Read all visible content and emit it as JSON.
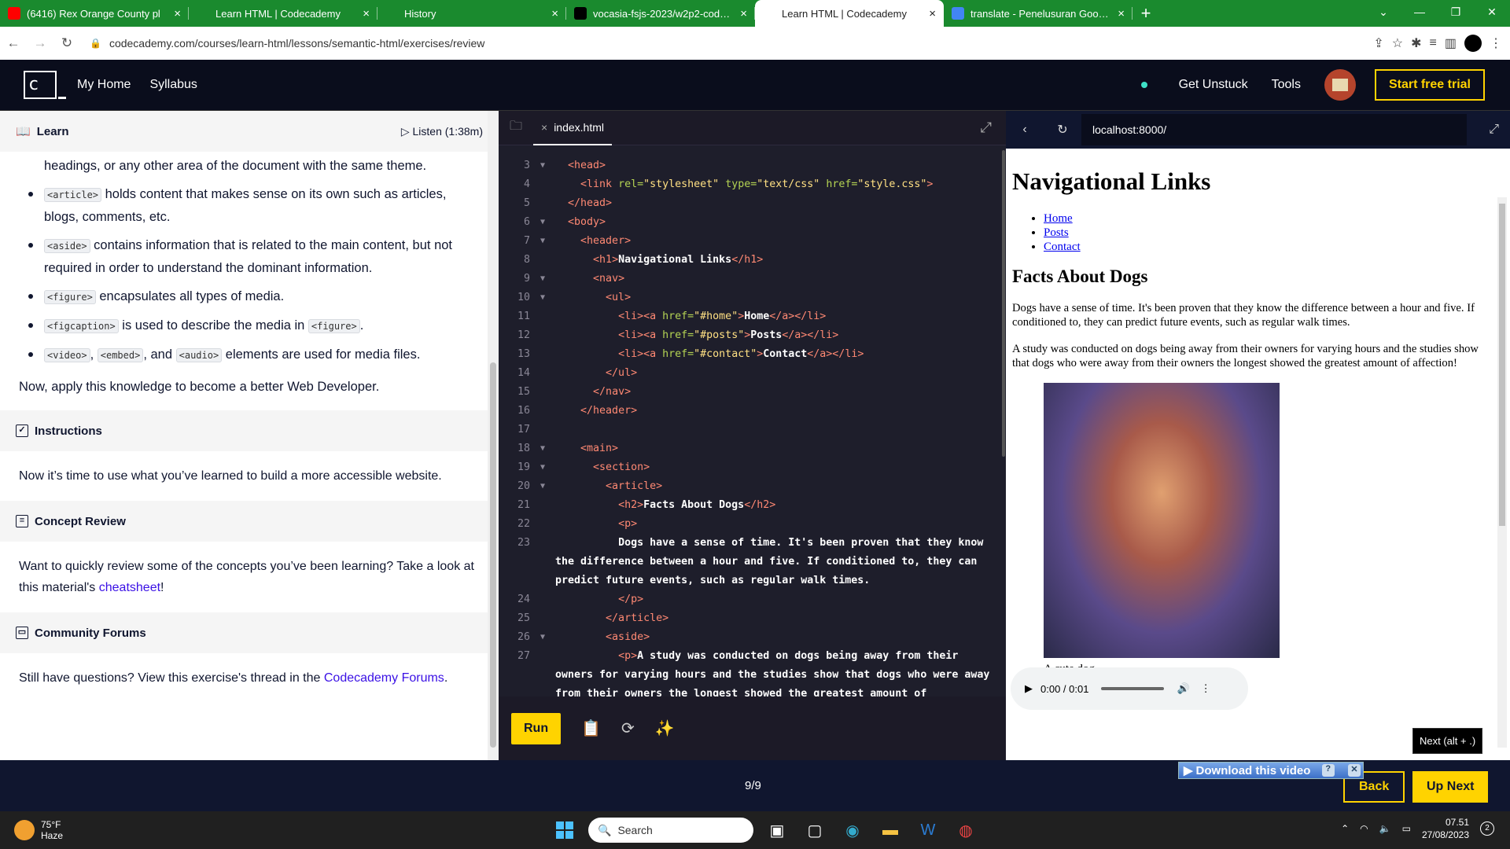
{
  "browser": {
    "tabs": [
      {
        "title": "(6416) Rex Orange County pl",
        "icon": "youtube-icon",
        "color": "#ff0000",
        "active": false
      },
      {
        "title": "Learn HTML | Codecademy",
        "icon": "codecademy-icon",
        "color": "#1a8a2e",
        "active": false
      },
      {
        "title": "History",
        "icon": "history-icon",
        "color": "#1a8a2e",
        "active": false
      },
      {
        "title": "vocasia-fsjs-2023/w2p2-codeca",
        "icon": "github-icon",
        "color": "#000000",
        "active": false
      },
      {
        "title": "Learn HTML | Codecademy",
        "icon": "codecademy-icon",
        "color": "#ffffff",
        "active": true
      },
      {
        "title": "translate - Penelusuran Google",
        "icon": "google-icon",
        "color": "#4285f4",
        "active": false
      }
    ],
    "url": "codecademy.com/courses/learn-html/lessons/semantic-html/exercises/review"
  },
  "topnav": {
    "logo": "c",
    "my_home": "My Home",
    "syllabus": "Syllabus",
    "get_unstuck": "Get Unstuck",
    "tools": "Tools",
    "start_trial": "Start free trial"
  },
  "learn": {
    "title": "Learn",
    "listen": "Listen (1:38m)",
    "top_partial": "headings, or any other area of the document with the same theme.",
    "items": [
      {
        "code": "<article>",
        "text": " holds content that makes sense on its own such as articles, blogs, comments, etc."
      },
      {
        "code": "<aside>",
        "text": " contains information that is related to the main content, but not required in order to understand the dominant information."
      },
      {
        "code": "<figure>",
        "text": " encapsulates all types of media."
      },
      {
        "code": "<figcaption>",
        "text": " is used to describe the media in ",
        "code2": "<figure>",
        "text2": "."
      },
      {
        "code": "<video>",
        "text": ", ",
        "code2": "<embed>",
        "text2": ", and ",
        "code3": "<audio>",
        "text3": " elements are used for media files."
      }
    ],
    "closing": "Now, apply this knowledge to become a better Web Developer.",
    "instructions_title": "Instructions",
    "instructions_body": "Now it’s time to use what you’ve learned to build a more accessible website.",
    "concept_title": "Concept Review",
    "concept_body": "Want to quickly review some of the concepts you’ve been learning? Take a look at this material's ",
    "concept_link": "cheatsheet",
    "concept_end": "!",
    "forums_title": "Community Forums",
    "forums_body": "Still have questions? View this exercise's thread in the ",
    "forums_link": "Codecademy Forums",
    "forums_end": "."
  },
  "editor": {
    "filename": "index.html",
    "run": "Run",
    "lines": [
      {
        "n": "3",
        "arrow": "▼",
        "html": "  <span class='tag'>&lt;head&gt;</span>"
      },
      {
        "n": "4",
        "arrow": "",
        "html": "    <span class='tag'>&lt;link</span> <span class='attr'>rel=</span><span class='val'>\"stylesheet\"</span> <span class='attr'>type=</span><span class='val'>\"text/css\"</span> <span class='attr'>href=</span><span class='val'>\"style.css\"</span><span class='tag'>&gt;</span>"
      },
      {
        "n": "5",
        "arrow": "",
        "html": "  <span class='tag'>&lt;/head&gt;</span>"
      },
      {
        "n": "6",
        "arrow": "▼",
        "html": "  <span class='tag'>&lt;body&gt;</span>"
      },
      {
        "n": "7",
        "arrow": "▼",
        "html": "    <span class='tag'>&lt;header&gt;</span>"
      },
      {
        "n": "8",
        "arrow": "",
        "html": "      <span class='tag'>&lt;h1&gt;</span><span class='txt'>Navigational Links</span><span class='tag'>&lt;/h1&gt;</span>"
      },
      {
        "n": "9",
        "arrow": "▼",
        "html": "      <span class='tag'>&lt;nav&gt;</span>"
      },
      {
        "n": "10",
        "arrow": "▼",
        "html": "        <span class='tag'>&lt;ul&gt;</span>"
      },
      {
        "n": "11",
        "arrow": "",
        "html": "          <span class='tag'>&lt;li&gt;&lt;a</span> <span class='attr'>href=</span><span class='val'>\"#home\"</span><span class='tag'>&gt;</span><span class='txt'>Home</span><span class='tag'>&lt;/a&gt;&lt;/li&gt;</span>"
      },
      {
        "n": "12",
        "arrow": "",
        "html": "          <span class='tag'>&lt;li&gt;&lt;a</span> <span class='attr'>href=</span><span class='val'>\"#posts\"</span><span class='tag'>&gt;</span><span class='txt'>Posts</span><span class='tag'>&lt;/a&gt;&lt;/li&gt;</span>"
      },
      {
        "n": "13",
        "arrow": "",
        "html": "          <span class='tag'>&lt;li&gt;&lt;a</span> <span class='attr'>href=</span><span class='val'>\"#contact\"</span><span class='tag'>&gt;</span><span class='txt'>Contact</span><span class='tag'>&lt;/a&gt;&lt;/li&gt;</span>"
      },
      {
        "n": "14",
        "arrow": "",
        "html": "        <span class='tag'>&lt;/ul&gt;</span>"
      },
      {
        "n": "15",
        "arrow": "",
        "html": "      <span class='tag'>&lt;/nav&gt;</span>"
      },
      {
        "n": "16",
        "arrow": "",
        "html": "    <span class='tag'>&lt;/header&gt;</span>"
      },
      {
        "n": "17",
        "arrow": "",
        "html": ""
      },
      {
        "n": "18",
        "arrow": "▼",
        "html": "    <span class='tag'>&lt;main&gt;</span>"
      },
      {
        "n": "19",
        "arrow": "▼",
        "html": "      <span class='tag'>&lt;section&gt;</span>"
      },
      {
        "n": "20",
        "arrow": "▼",
        "html": "        <span class='tag'>&lt;article&gt;</span>"
      },
      {
        "n": "21",
        "arrow": "",
        "html": "          <span class='tag'>&lt;h2&gt;</span><span class='txt'>Facts About Dogs</span><span class='tag'>&lt;/h2&gt;</span>"
      },
      {
        "n": "22",
        "arrow": "",
        "html": "          <span class='tag'>&lt;p&gt;</span>"
      },
      {
        "n": "23",
        "arrow": "",
        "html": "          <span class='txt'>Dogs have a sense of time. It's been proven that they know the difference between a hour and five. If conditioned to, they can predict future events, such as regular walk times.</span>"
      },
      {
        "n": "24",
        "arrow": "",
        "html": "          <span class='tag'>&lt;/p&gt;</span>"
      },
      {
        "n": "25",
        "arrow": "",
        "html": "        <span class='tag'>&lt;/article&gt;</span>"
      },
      {
        "n": "26",
        "arrow": "▼",
        "html": "        <span class='tag'>&lt;aside&gt;</span>"
      },
      {
        "n": "27",
        "arrow": "",
        "html": "          <span class='tag'>&lt;p&gt;</span><span class='txt'>A study was conducted on dogs being away from their owners for varying hours and the studies show that dogs who were away from their owners the longest showed the greatest amount of affection!</span>"
      }
    ]
  },
  "preview": {
    "url": "localhost:8000/",
    "h1": "Navigational Links",
    "links": [
      "Home",
      "Posts",
      "Contact"
    ],
    "h2": "Facts About Dogs",
    "p1": "Dogs have a sense of time. It's been proven that they know the difference between a hour and five. If conditioned to, they can predict future events, such as regular walk times.",
    "p2": "A study was conducted on dogs being away from their owners for varying hours and the studies show that dogs who were away from their owners the longest showed the greatest amount of affection!",
    "caption": "A cute dog.",
    "audio_time": "0:00 / 0:01"
  },
  "footer": {
    "counter": "9/9",
    "back": "Back",
    "up_next": "Up Next",
    "tooltip": "Next (alt + .)",
    "download": "Download this video"
  },
  "taskbar": {
    "temp": "75°F",
    "weather": "Haze",
    "search": "Search",
    "time": "07.51",
    "date": "27/08/2023",
    "notifications": "2"
  }
}
